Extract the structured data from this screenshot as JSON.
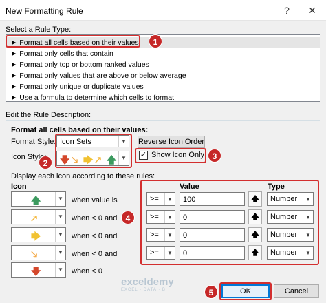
{
  "dialog": {
    "title": "New Formatting Rule",
    "help": "?",
    "close": "✕"
  },
  "rule_type": {
    "heading": "Select a Rule Type:",
    "items": [
      "► Format all cells based on their values",
      "► Format only cells that contain",
      "► Format only top or bottom ranked values",
      "► Format only values that are above or below average",
      "► Format only unique or duplicate values",
      "► Use a formula to determine which cells to format"
    ],
    "selected_index": 0
  },
  "description": {
    "heading": "Edit the Rule Description:",
    "format_all_label": "Format all cells based on their values:",
    "format_style_label": "Format Style:",
    "format_style_value": "Icon Sets",
    "reverse_icon_order": "Reverse Icon Order",
    "icon_style_label": "Icon Style:",
    "icon_style_icons": [
      "down-arrow-red",
      "down-right-arrow-orange",
      "right-arrow-yellow",
      "up-right-arrow-orange",
      "up-arrow-green"
    ],
    "show_icon_only_label": "Show Icon Only",
    "show_icon_only_checked": true,
    "display_rules_label": "Display each icon according to these rules:",
    "col_icon": "Icon",
    "col_value": "Value",
    "col_type": "Type",
    "rows": [
      {
        "icon": "up-arrow-green",
        "glyph": "🡅",
        "color": "#3c9a5f",
        "condition": "when value is",
        "operator": ">=",
        "value": "100",
        "type": "Number"
      },
      {
        "icon": "up-right-arrow-orange",
        "glyph": "🡕",
        "color": "#f4b942",
        "condition": "when < 0 and",
        "operator": ">=",
        "value": "0",
        "type": "Number"
      },
      {
        "icon": "right-arrow-yellow",
        "glyph": "🡆",
        "color": "#f1c232",
        "condition": "when < 0 and",
        "operator": ">=",
        "value": "0",
        "type": "Number"
      },
      {
        "icon": "down-right-arrow-orange",
        "glyph": "🡖",
        "color": "#f4a742",
        "condition": "when < 0 and",
        "operator": ">=",
        "value": "0",
        "type": "Number"
      },
      {
        "icon": "down-arrow-red",
        "glyph": "🡇",
        "color": "#d4472b",
        "condition": "when < 0",
        "operator": "",
        "value": "",
        "type": ""
      }
    ]
  },
  "buttons": {
    "ok": "OK",
    "cancel": "Cancel"
  },
  "annotations": [
    "1",
    "2",
    "3",
    "4",
    "5"
  ],
  "watermark": {
    "name": "exceldemy",
    "tagline": "EXCEL · DATA · BI"
  },
  "colors": {
    "highlight": "#d32f2f",
    "badge": "#c62828"
  }
}
